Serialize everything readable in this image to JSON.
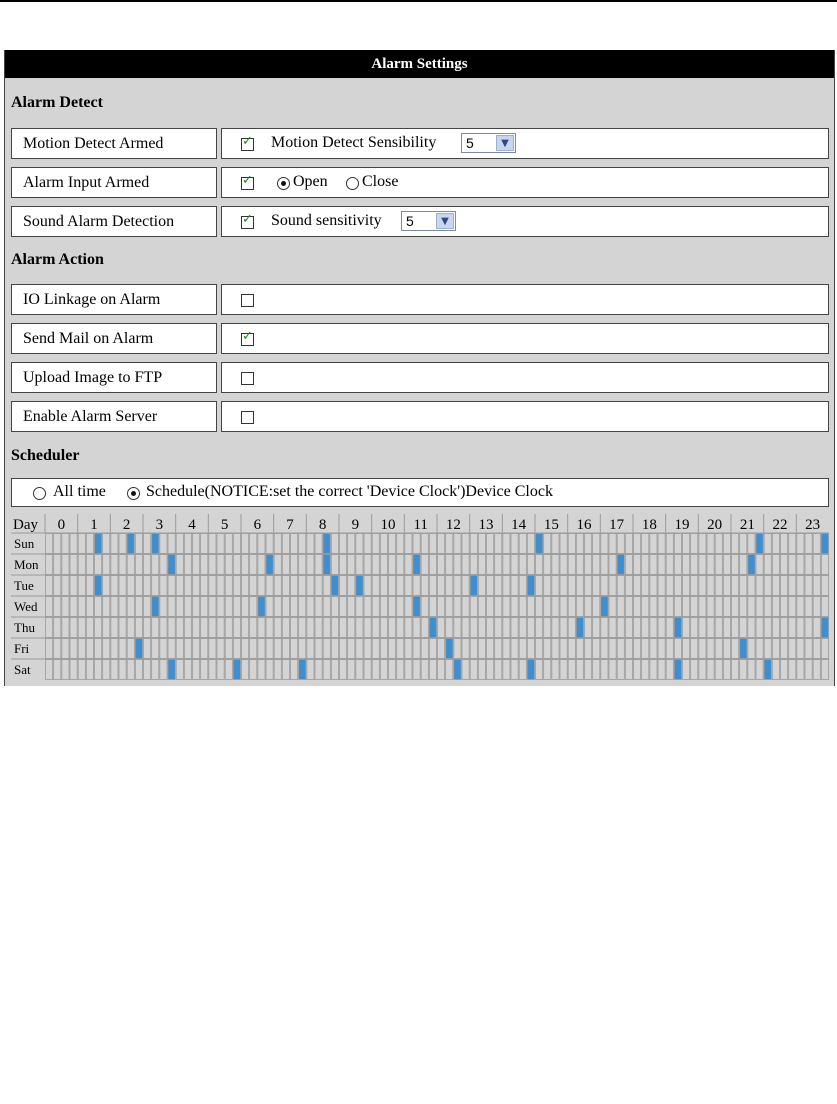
{
  "title": "Alarm Settings",
  "sections": {
    "alarm_detect": "Alarm Detect",
    "alarm_action": "Alarm Action",
    "scheduler": "Scheduler"
  },
  "detect_rows": [
    {
      "label": "Motion Detect Armed",
      "checked": true,
      "extra_label": "Motion Detect Sensibility",
      "select_value": "5"
    },
    {
      "label": "Alarm Input Armed",
      "checked": true,
      "radio_open": "Open",
      "radio_close": "Close",
      "selected": "Open"
    },
    {
      "label": "Sound Alarm Detection",
      "checked": true,
      "extra_label": "Sound sensitivity",
      "select_value": "5"
    }
  ],
  "action_rows": [
    {
      "label": "IO Linkage on Alarm",
      "checked": false
    },
    {
      "label": "Send Mail on Alarm",
      "checked": true
    },
    {
      "label": "Upload Image to FTP",
      "checked": false
    },
    {
      "label": "Enable Alarm Server",
      "checked": false
    }
  ],
  "scheduler": {
    "option_all_time": "All time",
    "option_schedule": "Schedule(NOTICE:set the correct 'Device Clock')Device Clock",
    "selected": "schedule"
  },
  "schedule_grid": {
    "header": "Day",
    "hours": [
      "0",
      "1",
      "2",
      "3",
      "4",
      "5",
      "6",
      "7",
      "8",
      "9",
      "10",
      "11",
      "12",
      "13",
      "14",
      "15",
      "16",
      "17",
      "18",
      "19",
      "20",
      "21",
      "22",
      "23"
    ],
    "days": [
      "Sun",
      "Mon",
      "Tue",
      "Wed",
      "Thu",
      "Fri",
      "Sat"
    ],
    "slots_per_hour": 4,
    "active_slots": {
      "Sun": [
        6,
        10,
        13,
        34,
        60,
        87,
        95
      ],
      "Mon": [
        15,
        27,
        34,
        45,
        70,
        86
      ],
      "Tue": [
        6,
        35,
        38,
        52,
        59
      ],
      "Wed": [
        13,
        26,
        45,
        68
      ],
      "Thu": [
        47,
        65,
        77,
        95
      ],
      "Fri": [
        11,
        49,
        85
      ],
      "Sat": [
        15,
        23,
        31,
        50,
        59,
        77,
        88
      ]
    },
    "colors": {
      "active": "#3e8ed0",
      "inactive": "#d4d4d4",
      "line": "#9a9a9a"
    }
  }
}
